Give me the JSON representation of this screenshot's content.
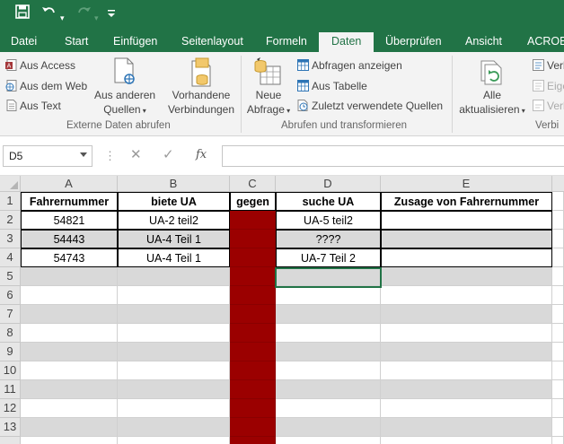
{
  "titlebar": {
    "save_icon": "save-icon",
    "undo_icon": "undo-icon",
    "redo_icon": "redo-icon",
    "customize_icon": "customize-quick-access-icon"
  },
  "tabs": [
    {
      "label": "Datei"
    },
    {
      "label": "Start"
    },
    {
      "label": "Einfügen"
    },
    {
      "label": "Seitenlayout"
    },
    {
      "label": "Formeln"
    },
    {
      "label": "Daten"
    },
    {
      "label": "Überprüfen"
    },
    {
      "label": "Ansicht"
    },
    {
      "label": "ACROBA"
    }
  ],
  "ribbon": {
    "externe": {
      "aus_access": "Aus Access",
      "aus_web": "Aus dem Web",
      "aus_text": "Aus Text",
      "andere_1": "Aus anderen",
      "andere_2": "Quellen",
      "vorh_1": "Vorhandene",
      "vorh_2": "Verbindungen",
      "label": "Externe Daten abrufen"
    },
    "abrufen": {
      "neue_1": "Neue",
      "neue_2": "Abfrage",
      "abfragen": "Abfragen anzeigen",
      "tabelle": "Aus Tabelle",
      "zuletzt": "Zuletzt verwendete Quellen",
      "label": "Abrufen und transformieren"
    },
    "verbindungen": {
      "alle_1": "Alle",
      "alle_2": "aktualisieren",
      "v1": "Verb",
      "v2": "Eige",
      "v3": "Verk",
      "label": "Verbi"
    }
  },
  "formula_bar": {
    "name_box": "D5",
    "fx": "fx",
    "value": ""
  },
  "sheet": {
    "columns": [
      "A",
      "B",
      "C",
      "D",
      "E"
    ],
    "rows": [
      "1",
      "2",
      "3",
      "4",
      "5",
      "6",
      "7",
      "8",
      "9",
      "10",
      "11",
      "12",
      "13",
      ""
    ],
    "header": [
      "Fahrernummer",
      "biete UA",
      "gegen",
      "suche UA",
      "Zusage von Fahrernummer"
    ],
    "data": [
      [
        "54821",
        "UA-2 teil2",
        "",
        "UA-5 teil2",
        ""
      ],
      [
        "54443",
        "UA-4 Teil 1",
        "",
        "????",
        ""
      ],
      [
        "54743",
        "UA-4 Teil 1",
        "",
        "UA-7 Teil 2",
        ""
      ]
    ],
    "colors": {
      "gegen_fill": "#9b0000",
      "band_fill": "#d9d9d9",
      "accent": "#217346"
    }
  }
}
